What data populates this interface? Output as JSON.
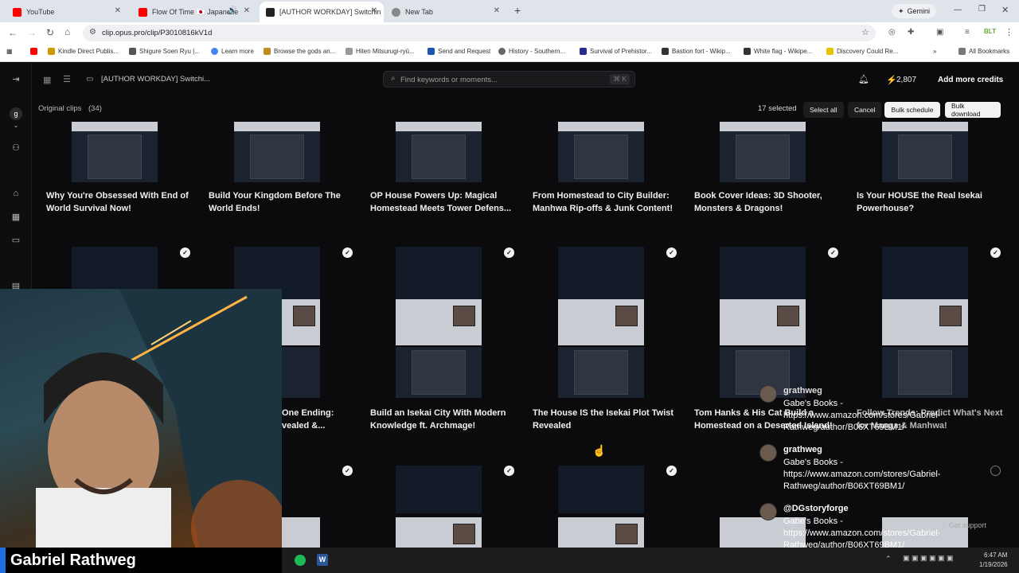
{
  "browser": {
    "tabs": [
      {
        "label": "YouTube",
        "color": "#ff0000"
      },
      {
        "label": "Flow Of Time 🇯🇵 Japanese",
        "color": "#ff0000"
      },
      {
        "label": "[AUTHOR WORKDAY] Switchin",
        "color": "#222222"
      },
      {
        "label": "New Tab",
        "color": "#888888"
      }
    ],
    "new_tab_symbol": "+",
    "profile_label": "Gemini",
    "url": "clip.opus.pro/clip/P3010816kV1d",
    "bookmarks": [
      "Kindle Direct Publis...",
      "Shigure Soen Ryu |...",
      "Learn more",
      "Browse the gods an...",
      "Hiten Mitsurugi-ryū...",
      "Send and Request",
      "History - Southern...",
      "Survival of Prehistor...",
      "Bastion fort - Wikip...",
      "White flag - Wikipe...",
      "Discovery Could Re..."
    ],
    "all_bookmarks": "All Bookmarks"
  },
  "app": {
    "project_title": "[AUTHOR WORKDAY] Switchi...",
    "search_placeholder": "Find keywords or moments...",
    "search_shortcut": "⌘ K",
    "credits": "2,807",
    "add_credits": "Add more credits",
    "section_label": "Original clips",
    "section_count": "(34)",
    "selected": "17 selected",
    "select_all": "Select all",
    "cancel": "Cancel",
    "bulk_schedule": "Bulk schedule",
    "bulk_download": "Bulk download",
    "avatar_letter": "g",
    "row1_titles": [
      "Why You're Obsessed With End of World Survival Now!",
      "Build Your Kingdom Before The World Ends!",
      "OP House Powers Up: Magical Homestead Meets Tower Defens...",
      "From Homestead to City Builder: Manhwa Rip-offs & Junk Content!",
      "Book Cover Ideas: 3D Shooter, Monsters & Dragons!",
      "Is Your HOUSE the Real Isekai Powerhouse?"
    ],
    "row2_titles": [
      "One Ending: vealed &...",
      "Build an Isekai City With Modern Knowledge ft. Archmage!",
      "The House IS the Isekai Plot Twist Revealed",
      "Tom Hanks & His Cat Build a Homestead on a Deserted Island!",
      "Follow Trends: Predict What's Next for Manga & Manhwa!"
    ],
    "get_support": "Get support"
  },
  "overlay": {
    "streamer_name": "Gabriel Rathweg",
    "chat": [
      {
        "user": "grathweg",
        "message": "Gabe's Books - https://www.amazon.com/stores/Gabriel-Rathweg/author/B06XT69BM1/"
      },
      {
        "user": "grathweg",
        "message": "Gabe's Books - https://www.amazon.com/stores/Gabriel-Rathweg/author/B06XT69BM1/"
      },
      {
        "user": "@DGstoryforge",
        "message": "Gabe's Books - https://www.amazon.com/stores/Gabriel-Rathweg/author/B06XT69BM1/"
      }
    ]
  },
  "taskbar": {
    "time": "6:47 AM",
    "date": "1/19/2026"
  },
  "colors": {
    "accent_white": "#ffffff",
    "app_bg": "#0b0b0d",
    "credit_bolt": "#f5c518"
  }
}
